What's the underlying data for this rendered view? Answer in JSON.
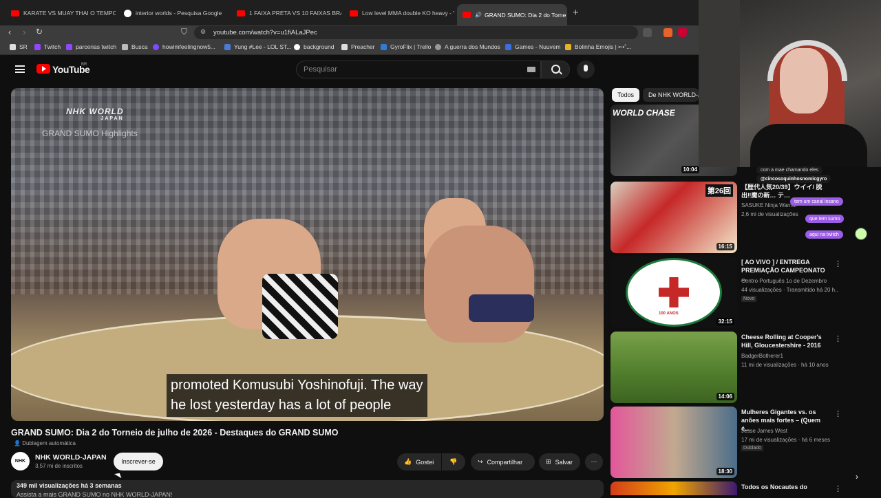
{
  "browser": {
    "tabs": [
      {
        "title": "KARATE VS MUAY THAI O TEMPO FE",
        "active": false
      },
      {
        "title": "interior worlds - Pesquisa Google",
        "active": false
      },
      {
        "title": "1 FAIXA PRETA VS 10 FAIXAS BRANCA",
        "active": false
      },
      {
        "title": "Low level MMA double KO heavy - Yo",
        "active": false
      },
      {
        "title": "GRAND SUMO: Dia 2 do Torne",
        "active": true
      }
    ],
    "new_tab": "+",
    "close_glyph": "×",
    "url": "youtube.com/watch?v=u1fiALaJPec",
    "bookmarks": [
      "SR",
      "Twitch",
      "parcerias twitch",
      "Busca",
      "howimfeelingnow5...",
      "Yung #Lee - LOL ST...",
      "background",
      "Preacher",
      "GyroFlix | Trello",
      "A guerra dos Mundos",
      "Games - Nuuvem",
      "Bolinha Emojis | •ᵕ•˚..."
    ]
  },
  "youtube": {
    "logo_text": "YouTube",
    "country": "BR",
    "search_placeholder": "Pesquisar"
  },
  "video": {
    "watermark_brand": "NHK WORLD",
    "watermark_sub": "JAPAN",
    "watermark_program": "GRAND SUMO Highlights",
    "caption_line1": "promoted Komusubi Yoshinofuji. The way",
    "caption_line2": "he lost yesterday has a lot of people",
    "title": "GRAND SUMO: Dia 2 do Torneio de julho de 2026 - Destaques do GRAND SUMO",
    "dubbing": "Dublagem automática",
    "channel": "NHK WORLD-JAPAN",
    "subscribers": "3,57 mi de inscritos",
    "subscribe_label": "Inscrever-se",
    "like_label": "Gostei",
    "share_label": "Compartilhar",
    "save_label": "Salvar",
    "views_date": "349 mil visualizações  há 3 semanas",
    "description_preview": "Assista a mais GRAND SUMO no NHK WORLD-JAPAN!"
  },
  "chips": [
    "Todos",
    "De NHK WORLD-J"
  ],
  "recommendations": [
    {
      "title": "",
      "meta1": "",
      "meta2": "",
      "duration": "10:04",
      "thumb_text": "WORLD CHASE"
    },
    {
      "title": "【歴代人気20/39】ウイイ/ 脱出‼魔の新… テ…",
      "meta1": "SASUKE Ninja Warrior",
      "meta2": "2,6 mi de visualizações",
      "duration": "16:15",
      "thumb_text": "第26回"
    },
    {
      "title": "[ AO VIVO ] / ENTREGA PREMIAÇÃO CAMPEONATO ...",
      "meta1": "Centro Português 1o de Dezembro",
      "meta2": "44 visualizações · Transmitido há 20 h...",
      "badge": "Novo",
      "duration": "32:15",
      "thumb_text": "100 ANOS"
    },
    {
      "title": "Cheese Rolling at Cooper's Hill, Gloucestershire - 2016",
      "meta1": "BadgerBotherer1",
      "meta2": "11 mi de visualizações · há 10 anos",
      "duration": "14:06"
    },
    {
      "title": "Mulheres Gigantes vs. os anões mais fortes – (Quem é...",
      "meta1": "Jesse James West",
      "meta2": "17 mi de visualizações · há 6 meses",
      "badge": "Dublado",
      "duration": "18:30"
    },
    {
      "title": "Todos os Nocautes do",
      "meta1": "",
      "meta2": "",
      "duration": ""
    }
  ],
  "stream_chat": [
    {
      "text": "com a mae chamando eles",
      "user": "@cincosoquinhosnomicgyro"
    },
    {
      "text": "tem um canal insano"
    },
    {
      "text": "que tem sumo"
    },
    {
      "text": "aqui na twitch"
    }
  ],
  "colors": {
    "yt_red": "#ff0000",
    "chat_purple": "#9b5de5",
    "bg": "#0f0f0f"
  }
}
